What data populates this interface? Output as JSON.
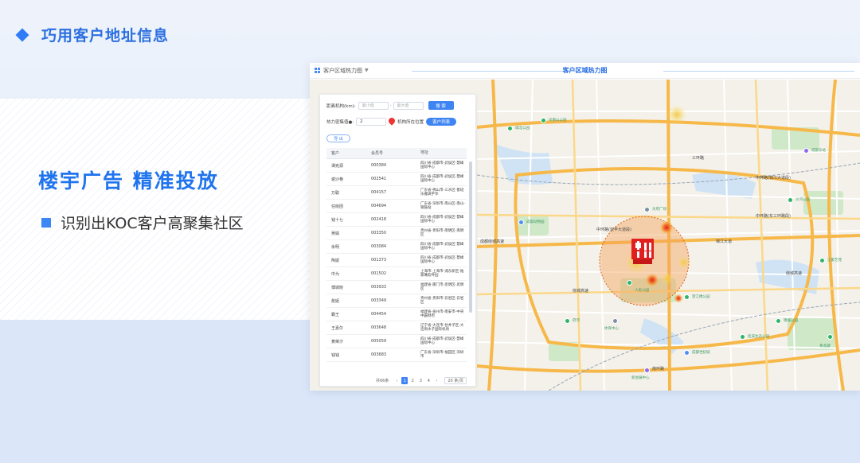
{
  "header": {
    "title": "巧用客户地址信息"
  },
  "main_title": "楼宇广告  精准投放",
  "bullet": "识别出KOC客户高聚集社区",
  "app": {
    "left_label": "客户区域热力图",
    "title": "客户区域热力图",
    "panel": {
      "distance_label": "距离机构(km):",
      "min_placeholder": "最小值",
      "max_placeholder": "最大值",
      "search_button": "搜 索",
      "heat_threshold_label": "热力密集值●:",
      "heat_threshold_value": "2",
      "org_location_label": "机构所在位置",
      "customer_list_button": "客户列表",
      "export_button": "导 出",
      "columns": [
        "客户",
        "会员号",
        "地址"
      ],
      "rows": [
        [
          "谭宪源",
          "000384",
          "四川省-成都市-武侯区-慧峰国际中心"
        ],
        [
          "谢沙艳",
          "002541",
          "四川省-成都市-武侯区-慧峰国际中心"
        ],
        [
          "万聪",
          "004157",
          "广东省-佛山市-三水区-鲁班乐雅璃宇亭"
        ],
        [
          "任晓团",
          "004694",
          "广东省-深圳市-南山区-南山-钢鼓站"
        ],
        [
          "钱十七",
          "002418",
          "四川省-成都市-武侯区-慧峰国际中心"
        ],
        [
          "吴娟",
          "003350",
          "贵州省-贵阳市-南明区-南明区"
        ],
        [
          "余明",
          "003084",
          "四川省-成都市-武侯区-慧峰国际中心"
        ],
        [
          "陶妮",
          "001373",
          "四川省-成都市-武侯区-慧峰国际中心"
        ],
        [
          "中为",
          "001502",
          "上海市-上海市-浦东新区-陆家嘴软件园"
        ],
        [
          "傅城晓",
          "003933",
          "福建省-厦门市-思明区-思明区"
        ],
        [
          "詹妮",
          "003349",
          "贵州省-贵阳市-云岩区-云岩区"
        ],
        [
          "霸王",
          "004454",
          "福建省-泉州市-南安市-中央中霸财府"
        ],
        [
          "王嘉尔",
          "003648",
          "辽宁省-大连市-甘井子区-大连周水子国际机场"
        ],
        [
          "黄荣汐",
          "005059",
          "四川省-成都市-武侯区-慧峰国际中心"
        ],
        [
          "钱钱",
          "003683",
          "广东省-深圳市-福田区-深圳市"
        ]
      ],
      "pager": {
        "total": "共66条",
        "prev": "‹",
        "pages": [
          "1",
          "2",
          "3",
          "4"
        ],
        "next": "›",
        "size": "20 条/页"
      }
    },
    "map": {
      "road_labels": [
        "绕城高速",
        "中环路(双丰大道段)",
        "中环路(锦江大道段)",
        "锦江大道",
        "中环路(东三环路段)",
        "三环路",
        "绕城高速",
        "成都绕城高速",
        "南环路"
      ],
      "poi_labels": [
        "城北公园",
        "凤凰山公园",
        "成都动物园",
        "人民公园",
        "望江楼公园",
        "锦城公园",
        "成都东站",
        "天府广场",
        "桂溪生态公园",
        "江家艺苑",
        "沙河公园",
        "青龙湖",
        "成都世纪城",
        "新会展中心",
        "府河",
        "体育中心"
      ]
    },
    "colors": {
      "accent": "#2f7cf6",
      "hotspot": "#e51c1c",
      "circle_fill": "#f5a25a"
    }
  }
}
